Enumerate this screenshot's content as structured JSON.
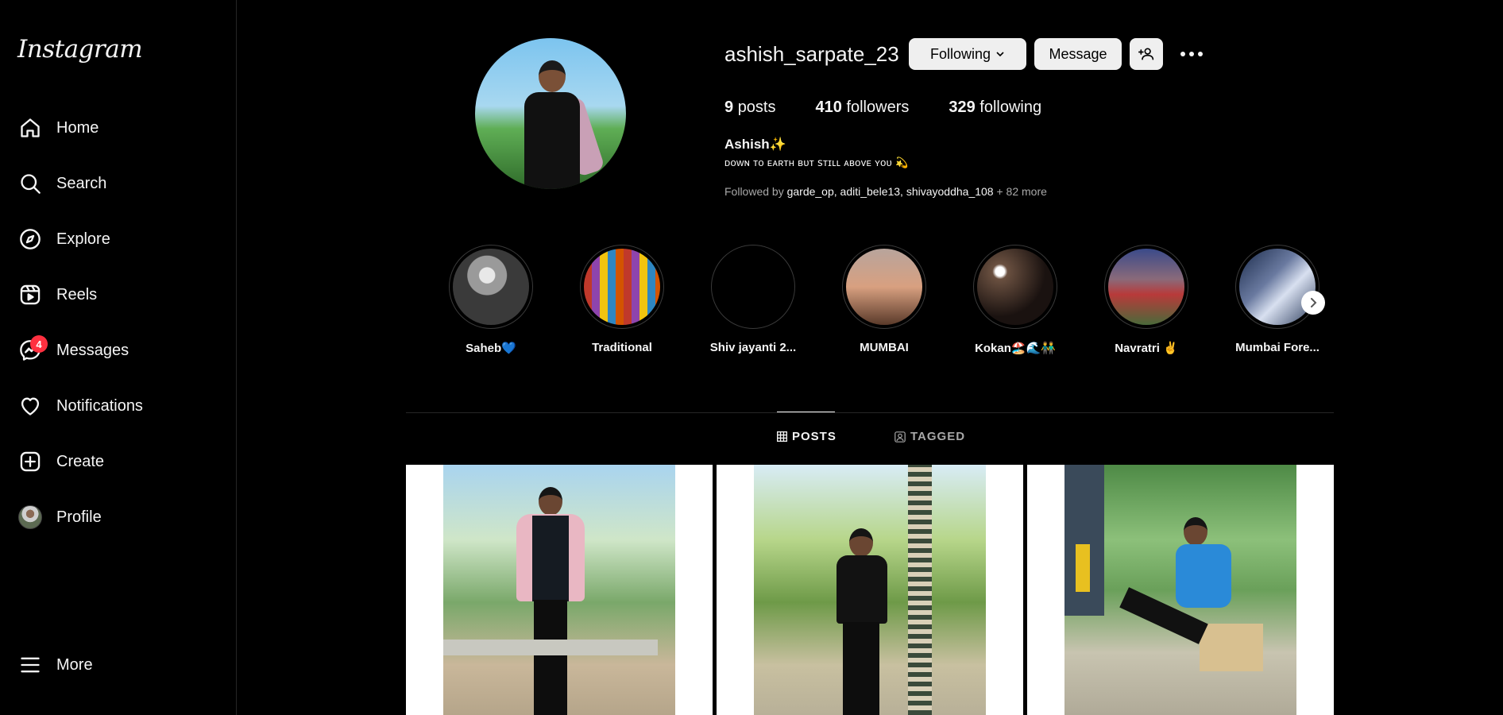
{
  "sidebar": {
    "logo": "Instagram",
    "items": [
      {
        "label": "Home",
        "icon": "home-icon"
      },
      {
        "label": "Search",
        "icon": "search-icon"
      },
      {
        "label": "Explore",
        "icon": "compass-icon"
      },
      {
        "label": "Reels",
        "icon": "reels-icon"
      },
      {
        "label": "Messages",
        "icon": "messenger-icon",
        "badge": "4"
      },
      {
        "label": "Notifications",
        "icon": "heart-icon"
      },
      {
        "label": "Create",
        "icon": "plus-square-icon"
      },
      {
        "label": "Profile",
        "icon": "avatar"
      }
    ],
    "more_label": "More"
  },
  "profile": {
    "username": "ashish_sarpate_23",
    "following_label": "Following",
    "message_label": "Message",
    "stats": {
      "posts_count": "9",
      "posts_label": "posts",
      "followers_count": "410",
      "followers_label": "followers",
      "following_count": "329",
      "following_label": "following"
    },
    "full_name": "Ashish✨",
    "bio": "ᴅᴏᴡɴ ᴛᴏ ᴇᴀʀᴛʜ ʙᴜᴛ ꜱᴛɪʟʟ ᴀʙᴏᴠᴇ ʏᴏᴜ 💫",
    "followed_by_prefix": "Followed by ",
    "followed_by_names": "garde_op, aditi_bele13, shivayoddha_108",
    "followed_by_more": " + 82 more"
  },
  "highlights": [
    {
      "label": "Saheb💙",
      "color": "#8a8a8a"
    },
    {
      "label": "Traditional",
      "color": "#7c5a7a"
    },
    {
      "label": "Shiv jayanti 2...",
      "color": "#000000"
    },
    {
      "label": "MUMBAI",
      "color": "#a27d6b"
    },
    {
      "label": "Kokan🏖️🌊👬",
      "color": "#3a2a22"
    },
    {
      "label": "Navratri ✌️",
      "color": "#6e6a8a"
    },
    {
      "label": "Mumbai Fore...",
      "color": "#4a5a78"
    }
  ],
  "tabs": {
    "posts": "POSTS",
    "tagged": "TAGGED"
  },
  "colors": {
    "accent": "#0095f6",
    "badge": "#ff3040",
    "background": "#000000",
    "button": "#efefef"
  }
}
